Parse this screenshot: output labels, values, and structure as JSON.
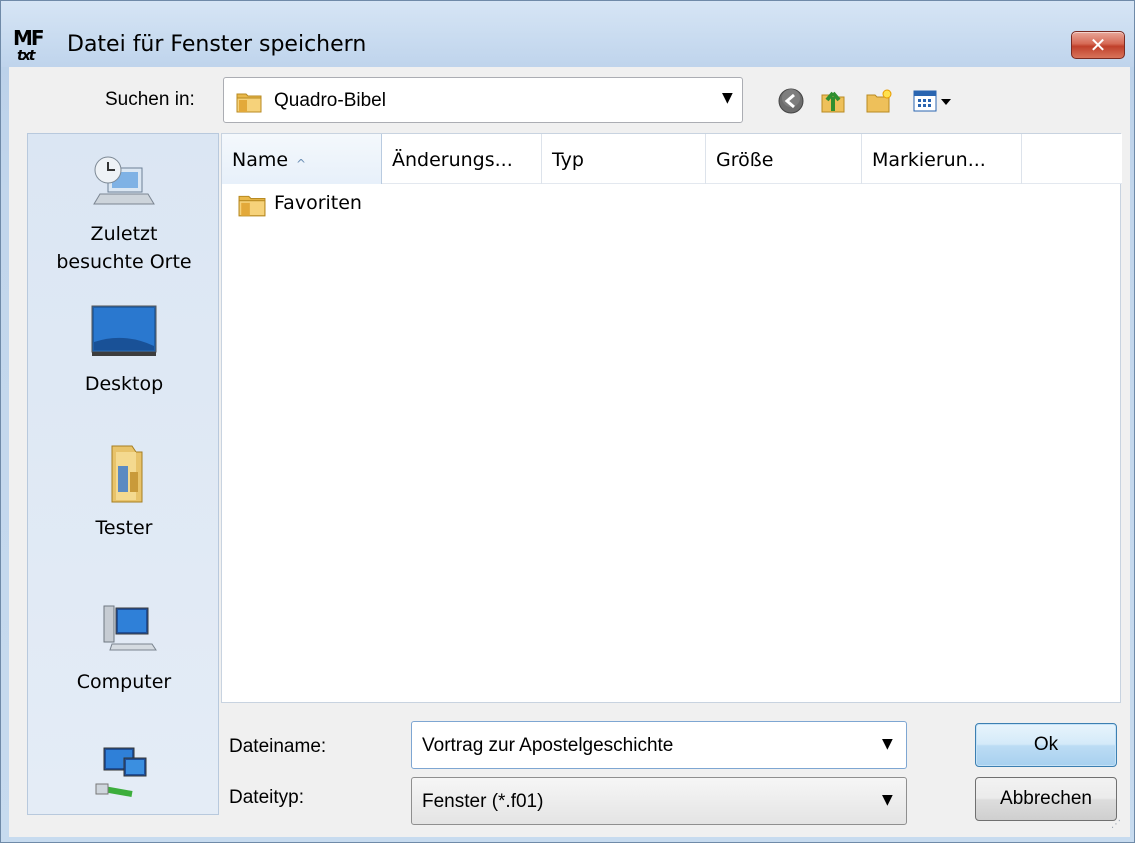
{
  "window": {
    "title": "Datei für Fenster speichern",
    "app_icon_text_top": "MF",
    "app_icon_text_bottom": "txt",
    "close_glyph": "✕"
  },
  "look_in": {
    "label": "Suchen in:",
    "value": "Quadro-Bibel",
    "arrow": "▼"
  },
  "toolbar": {
    "icons": [
      "back-icon",
      "up-folder-icon",
      "new-folder-icon",
      "view-menu-icon"
    ],
    "view_arrow": "▾"
  },
  "places": [
    {
      "label_line1": "Zuletzt",
      "label_line2": "besuchte Orte",
      "icon": "recent-places-icon"
    },
    {
      "label_line1": "Desktop",
      "label_line2": "",
      "icon": "desktop-icon"
    },
    {
      "label_line1": "Tester",
      "label_line2": "",
      "icon": "user-folder-icon"
    },
    {
      "label_line1": "Computer",
      "label_line2": "",
      "icon": "computer-icon"
    },
    {
      "label_line1": "",
      "label_line2": "",
      "icon": "network-icon"
    }
  ],
  "columns": [
    "Name",
    "Änderungs...",
    "Typ",
    "Größe",
    "Markierun..."
  ],
  "sort_indicator": "^",
  "files": [
    {
      "name": "Favoriten",
      "icon": "folder-icon"
    }
  ],
  "filename": {
    "label": "Dateiname:",
    "value": "Vortrag zur Apostelgeschichte",
    "arrow": "▼"
  },
  "filetype": {
    "label": "Dateityp:",
    "value": "Fenster (*.f01)",
    "arrow": "▼"
  },
  "buttons": {
    "ok": "Ok",
    "cancel": "Abbrechen"
  },
  "colors": {
    "titlebar": "#bfd4ec",
    "close": "#c0402b",
    "ok_border": "#3c7fb1"
  }
}
